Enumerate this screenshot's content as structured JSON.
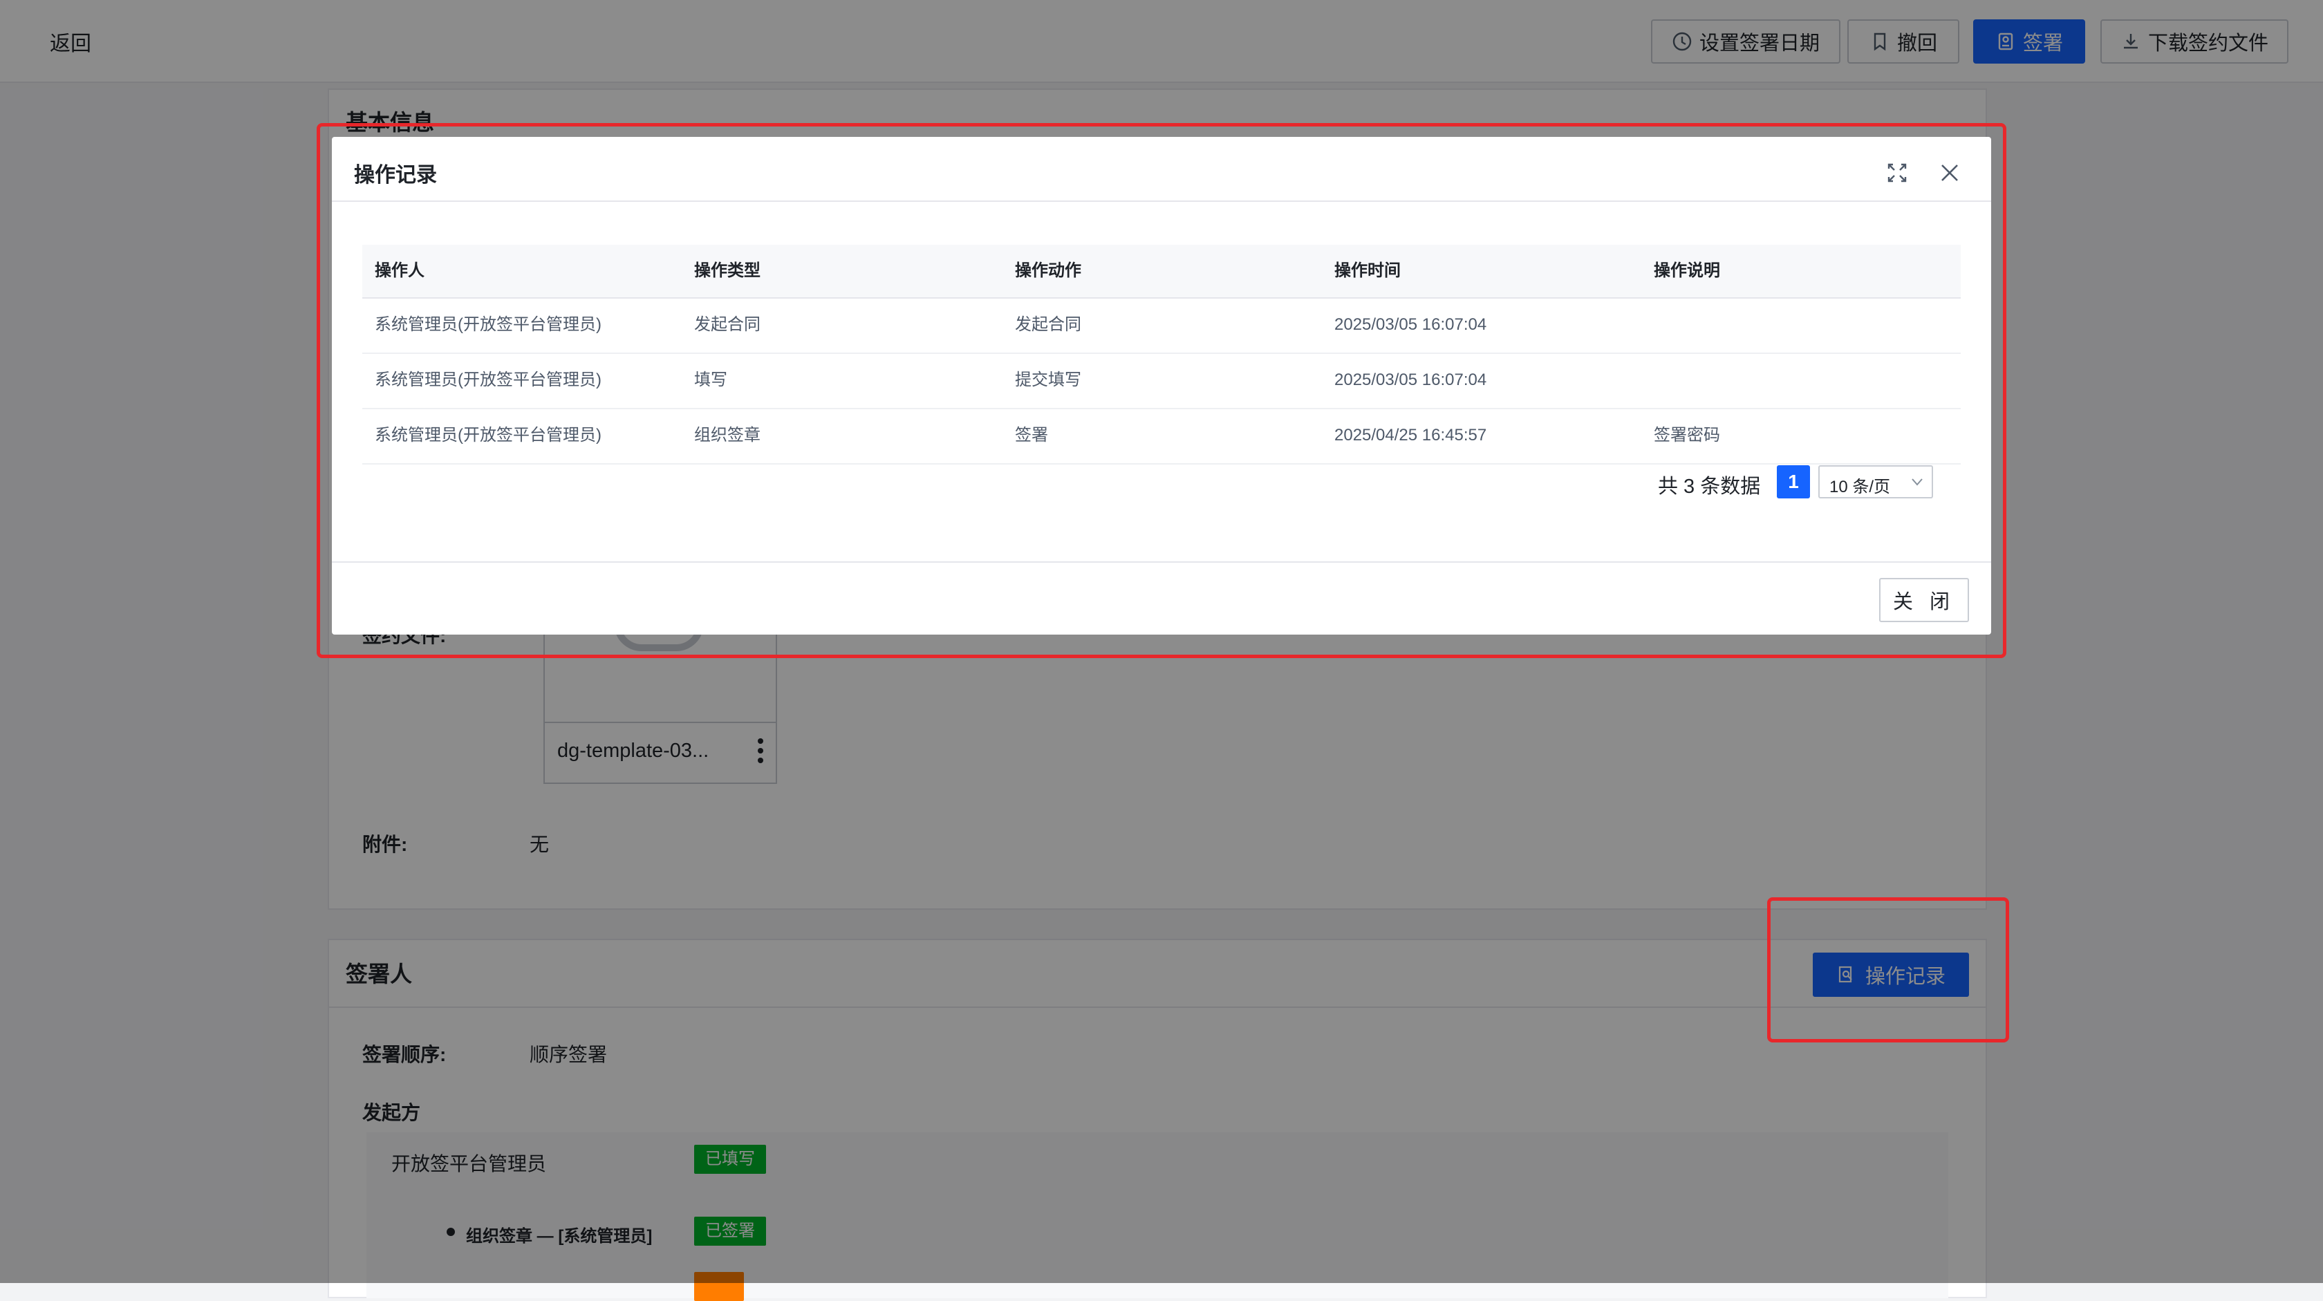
{
  "header": {
    "back_label": "返回",
    "set_date_label": "设置签署日期",
    "revoke_label": "撤回",
    "sign_label": "签署",
    "download_label": "下载签约文件"
  },
  "basic_info": {
    "title": "基本信息",
    "file_label": "签约文件:",
    "file_name": "dg-template-03...",
    "attachment_label": "附件:",
    "attachment_value": "无"
  },
  "signers": {
    "title": "签署人",
    "op_record_button": "操作记录",
    "order_label": "签署顺序:",
    "order_value": "顺序签署",
    "initiator_label": "发起方",
    "initiator_name": "开放签平台管理员",
    "initiator_status": "已填写",
    "seal_item": "组织签章 — [系统管理员]",
    "seal_status": "已签署"
  },
  "modal": {
    "title": "操作记录",
    "columns": [
      "操作人",
      "操作类型",
      "操作动作",
      "操作时间",
      "操作说明"
    ],
    "rows": [
      [
        "系统管理员(开放签平台管理员)",
        "发起合同",
        "发起合同",
        "2025/03/05 16:07:04",
        ""
      ],
      [
        "系统管理员(开放签平台管理员)",
        "填写",
        "提交填写",
        "2025/03/05 16:07:04",
        ""
      ],
      [
        "系统管理员(开放签平台管理员)",
        "组织签章",
        "签署",
        "2025/04/25 16:45:57",
        "签署密码"
      ]
    ],
    "total_text": "共 3 条数据",
    "current_page": "1",
    "page_size": "10 条/页",
    "close_label": "关 闭"
  },
  "colors": {
    "primary": "#1664ff",
    "annotation": "#e8272b",
    "success": "#00b42a"
  }
}
